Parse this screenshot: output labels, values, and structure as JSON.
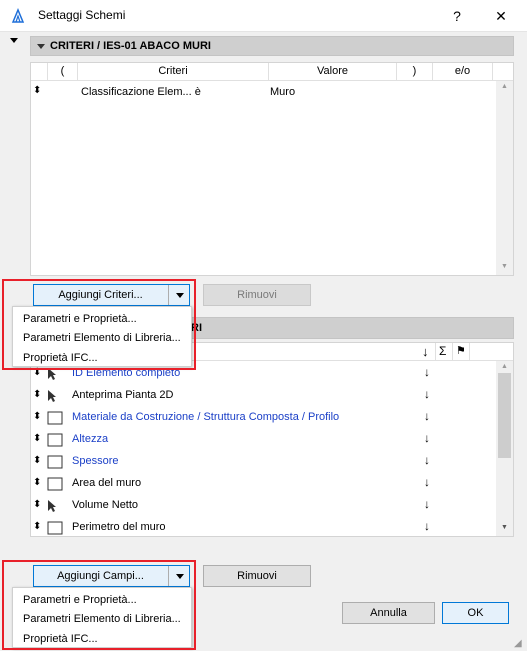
{
  "window": {
    "title": "Settaggi Schemi",
    "help": "?",
    "close": "✕"
  },
  "criteria_section": {
    "title": "CRITERI / IES-01 ABACO MURI"
  },
  "criteria_table": {
    "headers": [
      "(",
      "Criteri",
      "Valore",
      ")",
      "e/o"
    ],
    "rows": [
      {
        "criterio": "Classificazione Elem... è",
        "valore": "Muro"
      }
    ]
  },
  "criteria_buttons": {
    "add": "Aggiungi Criteri...",
    "remove": "Rimuovi"
  },
  "criteria_menu": {
    "items": [
      "Parametri e Proprietà...",
      "Parametri Elemento di Libreria...",
      "Proprietà IFC..."
    ]
  },
  "fields_section": {
    "title_suffix": "RI"
  },
  "fields_header": {
    "sort_icon": "↓",
    "sum_icon": "Σ",
    "flag_icon": "⚑"
  },
  "fields_list": {
    "rows": [
      {
        "label": "ID Elemento completo",
        "blue": true,
        "icon": "cursor"
      },
      {
        "label": "Anteprima Pianta 2D",
        "blue": false,
        "icon": "cursor"
      },
      {
        "label": "Materiale da Costruzione / Struttura Composta / Profilo",
        "blue": true,
        "icon": "box"
      },
      {
        "label": "Altezza",
        "blue": true,
        "icon": "box"
      },
      {
        "label": "Spessore",
        "blue": true,
        "icon": "box"
      },
      {
        "label": "Area del muro",
        "blue": false,
        "icon": "box"
      },
      {
        "label": "Volume Netto",
        "blue": false,
        "icon": "cursor"
      },
      {
        "label": "Perimetro del muro",
        "blue": false,
        "icon": "box"
      }
    ]
  },
  "fields_buttons": {
    "add": "Aggiungi Campi...",
    "remove": "Rimuovi"
  },
  "fields_menu": {
    "items": [
      "Parametri e Proprietà...",
      "Parametri Elemento di Libreria...",
      "Proprietà IFC..."
    ]
  },
  "dialog_buttons": {
    "cancel": "Annulla",
    "ok": "OK"
  },
  "colors": {
    "highlight": "#e8202a",
    "link_blue": "#1a3fc7",
    "accent": "#0078d7"
  }
}
